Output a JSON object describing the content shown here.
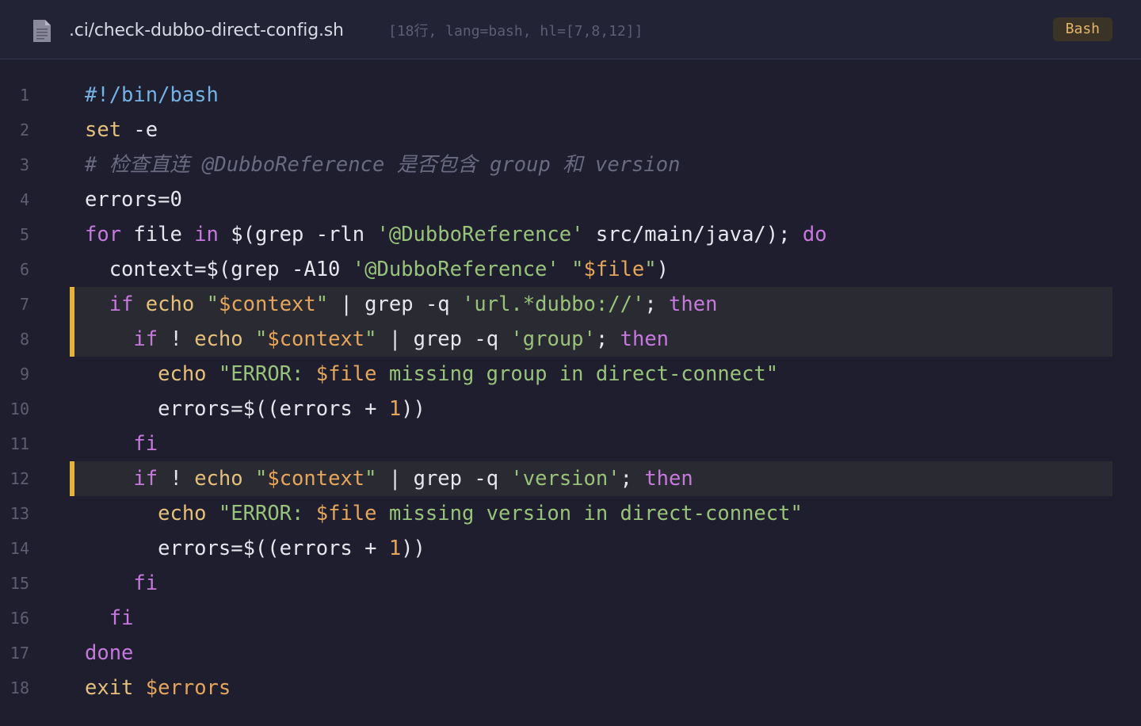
{
  "header": {
    "file_path": ".ci/check-dubbo-direct-config.sh",
    "meta": "[18行, lang=bash, hl=[7,8,12]]",
    "language": "Bash",
    "file_icon": "document-icon"
  },
  "colors": {
    "background": "#1e1e2f",
    "header_background": "#232336",
    "highlight_bar": "#e2b340",
    "highlight_background": "#2a2a33",
    "keyword": "#c678dd",
    "command": "#e5c07b",
    "string": "#98c379",
    "variable": "#e5a65c",
    "comment": "#6a6a80",
    "shebang": "#74b2e4"
  },
  "highlighted_lines": [
    7,
    8,
    12
  ],
  "lines": [
    {
      "n": "1",
      "tokens": [
        {
          "t": "#!/bin/bash",
          "c": "shebang"
        }
      ]
    },
    {
      "n": "2",
      "tokens": [
        {
          "t": "set",
          "c": "cmd"
        },
        {
          "t": " -e",
          "c": "txt"
        }
      ]
    },
    {
      "n": "3",
      "tokens": [
        {
          "t": "# 检查直连 @DubboReference 是否包含 group 和 version",
          "c": "com"
        }
      ]
    },
    {
      "n": "4",
      "tokens": [
        {
          "t": "errors=0",
          "c": "txt"
        }
      ]
    },
    {
      "n": "5",
      "tokens": [
        {
          "t": "for",
          "c": "kw"
        },
        {
          "t": " file ",
          "c": "txt"
        },
        {
          "t": "in",
          "c": "kw"
        },
        {
          "t": " $(grep -rln ",
          "c": "txt"
        },
        {
          "t": "'@DubboReference'",
          "c": "str"
        },
        {
          "t": " src/main/java/); ",
          "c": "txt"
        },
        {
          "t": "do",
          "c": "kw"
        }
      ]
    },
    {
      "n": "6",
      "tokens": [
        {
          "t": "  context=$(grep -A10 ",
          "c": "txt"
        },
        {
          "t": "'@DubboReference'",
          "c": "str"
        },
        {
          "t": " ",
          "c": "txt"
        },
        {
          "t": "\"",
          "c": "str"
        },
        {
          "t": "$file",
          "c": "var"
        },
        {
          "t": "\"",
          "c": "str"
        },
        {
          "t": ")",
          "c": "txt"
        }
      ]
    },
    {
      "n": "7",
      "tokens": [
        {
          "t": "  ",
          "c": "txt"
        },
        {
          "t": "if",
          "c": "kw"
        },
        {
          "t": " ",
          "c": "txt"
        },
        {
          "t": "echo",
          "c": "cmd"
        },
        {
          "t": " ",
          "c": "txt"
        },
        {
          "t": "\"",
          "c": "str"
        },
        {
          "t": "$context",
          "c": "var"
        },
        {
          "t": "\"",
          "c": "str"
        },
        {
          "t": " | grep -q ",
          "c": "txt"
        },
        {
          "t": "'url.*dubbo://'",
          "c": "str"
        },
        {
          "t": "; ",
          "c": "txt"
        },
        {
          "t": "then",
          "c": "kw"
        }
      ]
    },
    {
      "n": "8",
      "tokens": [
        {
          "t": "    ",
          "c": "txt"
        },
        {
          "t": "if",
          "c": "kw"
        },
        {
          "t": " ! ",
          "c": "txt"
        },
        {
          "t": "echo",
          "c": "cmd"
        },
        {
          "t": " ",
          "c": "txt"
        },
        {
          "t": "\"",
          "c": "str"
        },
        {
          "t": "$context",
          "c": "var"
        },
        {
          "t": "\"",
          "c": "str"
        },
        {
          "t": " | grep -q ",
          "c": "txt"
        },
        {
          "t": "'group'",
          "c": "str"
        },
        {
          "t": "; ",
          "c": "txt"
        },
        {
          "t": "then",
          "c": "kw"
        }
      ]
    },
    {
      "n": "9",
      "tokens": [
        {
          "t": "      ",
          "c": "txt"
        },
        {
          "t": "echo",
          "c": "cmd"
        },
        {
          "t": " ",
          "c": "txt"
        },
        {
          "t": "\"ERROR: ",
          "c": "str"
        },
        {
          "t": "$file",
          "c": "var"
        },
        {
          "t": " missing group in direct-connect\"",
          "c": "str"
        }
      ]
    },
    {
      "n": "10",
      "tokens": [
        {
          "t": "      errors=$((errors + ",
          "c": "txt"
        },
        {
          "t": "1",
          "c": "num"
        },
        {
          "t": "))",
          "c": "txt"
        }
      ]
    },
    {
      "n": "11",
      "tokens": [
        {
          "t": "    ",
          "c": "txt"
        },
        {
          "t": "fi",
          "c": "kw"
        }
      ]
    },
    {
      "n": "12",
      "tokens": [
        {
          "t": "    ",
          "c": "txt"
        },
        {
          "t": "if",
          "c": "kw"
        },
        {
          "t": " ! ",
          "c": "txt"
        },
        {
          "t": "echo",
          "c": "cmd"
        },
        {
          "t": " ",
          "c": "txt"
        },
        {
          "t": "\"",
          "c": "str"
        },
        {
          "t": "$context",
          "c": "var"
        },
        {
          "t": "\"",
          "c": "str"
        },
        {
          "t": " | grep -q ",
          "c": "txt"
        },
        {
          "t": "'version'",
          "c": "str"
        },
        {
          "t": "; ",
          "c": "txt"
        },
        {
          "t": "then",
          "c": "kw"
        }
      ]
    },
    {
      "n": "13",
      "tokens": [
        {
          "t": "      ",
          "c": "txt"
        },
        {
          "t": "echo",
          "c": "cmd"
        },
        {
          "t": " ",
          "c": "txt"
        },
        {
          "t": "\"ERROR: ",
          "c": "str"
        },
        {
          "t": "$file",
          "c": "var"
        },
        {
          "t": " missing version in direct-connect\"",
          "c": "str"
        }
      ]
    },
    {
      "n": "14",
      "tokens": [
        {
          "t": "      errors=$((errors + ",
          "c": "txt"
        },
        {
          "t": "1",
          "c": "num"
        },
        {
          "t": "))",
          "c": "txt"
        }
      ]
    },
    {
      "n": "15",
      "tokens": [
        {
          "t": "    ",
          "c": "txt"
        },
        {
          "t": "fi",
          "c": "kw"
        }
      ]
    },
    {
      "n": "16",
      "tokens": [
        {
          "t": "  ",
          "c": "txt"
        },
        {
          "t": "fi",
          "c": "kw"
        }
      ]
    },
    {
      "n": "17",
      "tokens": [
        {
          "t": "done",
          "c": "kw"
        }
      ]
    },
    {
      "n": "18",
      "tokens": [
        {
          "t": "exit",
          "c": "cmd"
        },
        {
          "t": " ",
          "c": "txt"
        },
        {
          "t": "$errors",
          "c": "var"
        }
      ]
    }
  ]
}
